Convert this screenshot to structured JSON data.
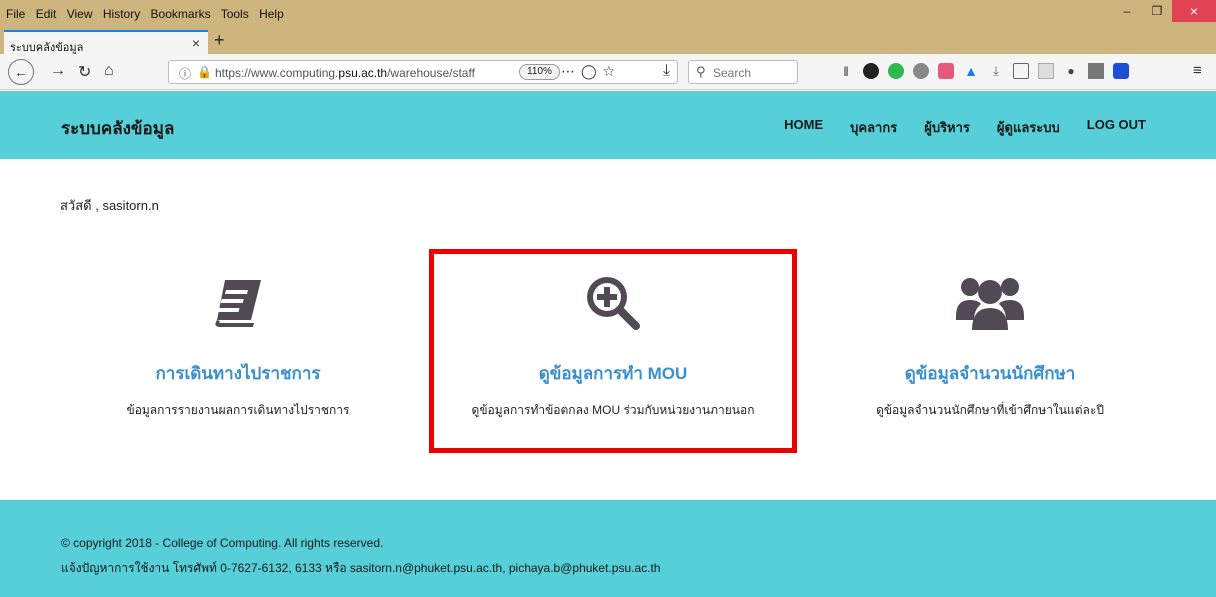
{
  "browser": {
    "menu": [
      "File",
      "Edit",
      "View",
      "History",
      "Bookmarks",
      "Tools",
      "Help"
    ],
    "tab_title": "ระบบคลังข้อมูล",
    "tab_close": "×",
    "new_tab": "+",
    "url_prefix": "https://www.computing.",
    "url_domain": "psu.ac.th",
    "url_suffix": "/warehouse/staff",
    "zoom": "110%",
    "search_placeholder": "Search",
    "window_minimize": "–",
    "window_restore": "❐",
    "window_close": "×"
  },
  "header": {
    "brand": "ระบบคลังข้อมูล",
    "nav": [
      "HOME",
      "บุคลากร",
      "ผู้บริหาร",
      "ผู้ดูแลระบบ",
      "LOG OUT"
    ]
  },
  "greeting": "สวัสดี , sasitorn.n",
  "cards": [
    {
      "icon": "book-icon",
      "title": "การเดินทางไปราชการ",
      "desc": "ข้อมูลการรายงานผลการเดินทางไปราชการ"
    },
    {
      "icon": "search-plus-icon",
      "title": "ดูข้อมูลการทำ MOU",
      "desc": "ดูข้อมูลการทำข้อตกลง MOU ร่วมกับหน่วยงานภายนอก"
    },
    {
      "icon": "users-icon",
      "title": "ดูข้อมูลจำนวนนักศึกษา",
      "desc": "ดูข้อมูลจำนวนนักศึกษาที่เข้าศึกษาในแต่ละปี"
    }
  ],
  "footer": {
    "copyright": "© copyright 2018 - College of Computing. All rights reserved.",
    "contact": "แจ้งปัญหาการใช้งาน โทรศัพท์ 0-7627-6132, 6133 หรือ sasitorn.n@phuket.psu.ac.th, pichaya.b@phuket.psu.ac.th"
  },
  "colors": {
    "accent": "#57cfd8",
    "link": "#3a8fce",
    "icon": "#514a55",
    "highlight": "#ee0000"
  }
}
